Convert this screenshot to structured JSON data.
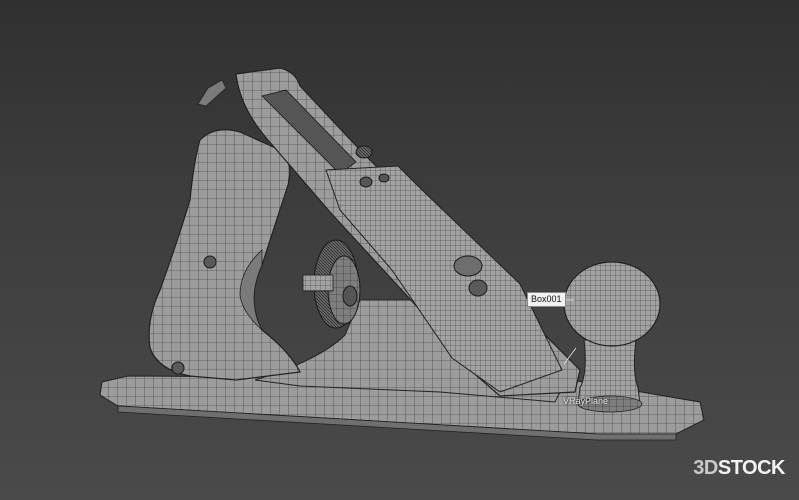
{
  "viewport": {
    "background": "#3a3a3a",
    "wire_color": "#2a2a2a",
    "surface_color": "#9a9a9a"
  },
  "object_labels": {
    "box": "Box001",
    "plane": "VRayPlane"
  },
  "watermark": {
    "part1": "3D",
    "part2": "STOCK"
  }
}
